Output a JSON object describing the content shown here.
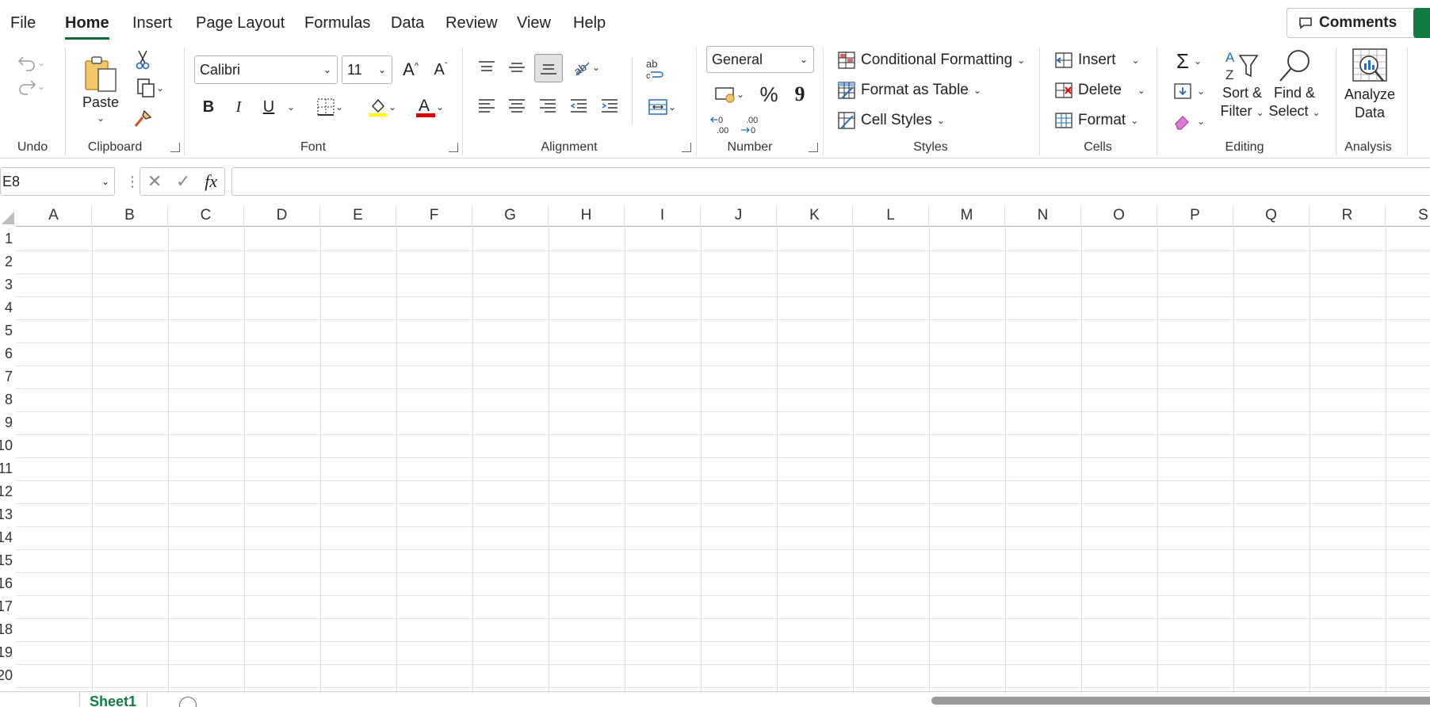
{
  "menu": {
    "tabs": [
      {
        "label": "File"
      },
      {
        "label": "Home"
      },
      {
        "label": "Insert"
      },
      {
        "label": "Page Layout"
      },
      {
        "label": "Formulas"
      },
      {
        "label": "Data"
      },
      {
        "label": "Review"
      },
      {
        "label": "View"
      },
      {
        "label": "Help"
      }
    ],
    "active_tab": "Home",
    "comments_label": "Comments"
  },
  "ribbon": {
    "groups": {
      "undo": "Undo",
      "clipboard": "Clipboard",
      "font": "Font",
      "alignment": "Alignment",
      "number": "Number",
      "styles": "Styles",
      "cells": "Cells",
      "editing": "Editing",
      "analysis": "Analysis"
    },
    "clipboard": {
      "paste_label": "Paste"
    },
    "font": {
      "font_name": "Calibri",
      "font_size": "11",
      "bold": "B",
      "italic": "I",
      "underline": "U"
    },
    "number": {
      "format": "General",
      "percent": "%",
      "comma": "9"
    },
    "styles": {
      "conditional_formatting": "Conditional Formatting",
      "format_as_table": "Format as Table",
      "cell_styles": "Cell Styles"
    },
    "cells": {
      "insert": "Insert",
      "delete": "Delete",
      "format": "Format"
    },
    "editing": {
      "sort_filter_line1": "Sort &",
      "sort_filter_line2": "Filter",
      "find_select_line1": "Find &",
      "find_select_line2": "Select"
    },
    "analysis": {
      "analyze_line1": "Analyze",
      "analyze_line2": "Data"
    }
  },
  "formula_bar": {
    "name_box": "E8",
    "fx": "fx",
    "formula": ""
  },
  "grid": {
    "columns": [
      "A",
      "B",
      "C",
      "D",
      "E",
      "F",
      "G",
      "H",
      "I",
      "J",
      "K",
      "L",
      "M",
      "N",
      "O",
      "P",
      "Q",
      "R",
      "S"
    ],
    "rows": [
      "1",
      "2",
      "3",
      "4",
      "5",
      "6",
      "7",
      "8",
      "9",
      "10",
      "11",
      "12",
      "13",
      "14",
      "15",
      "16",
      "17",
      "18",
      "19",
      "20"
    ]
  },
  "sheets": {
    "tabs": [
      "Sheet1"
    ],
    "active": "Sheet1"
  },
  "colors": {
    "accent": "#107c41",
    "active_tab_underline": "#0f6b3a",
    "highlight_yellow": "#ffff00",
    "font_red": "#e00000"
  }
}
